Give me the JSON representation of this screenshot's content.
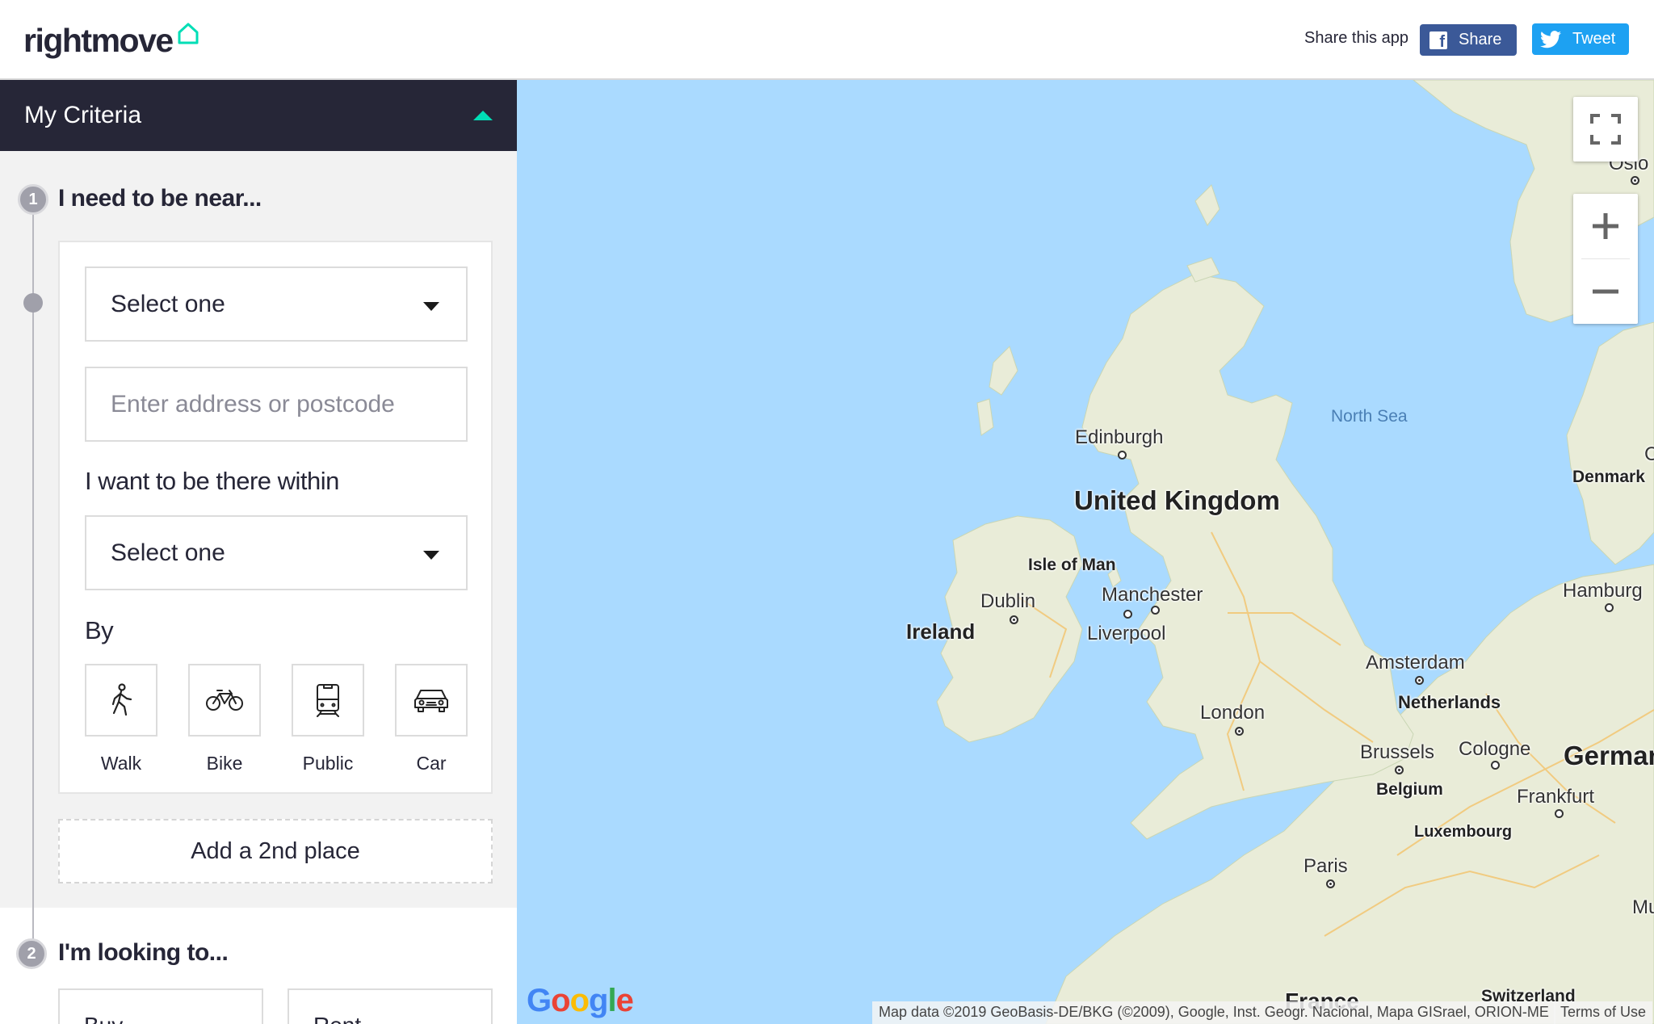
{
  "header": {
    "logo_text": "rightmove",
    "share_label": "Share this app",
    "share_button": "Share",
    "tweet_button": "Tweet",
    "colors": {
      "facebook": "#3b5998",
      "twitter": "#1da1f2",
      "brand_accent": "#00deb6"
    }
  },
  "sidebar": {
    "criteria_title": "My Criteria",
    "step1": {
      "number": "1",
      "title": "I need to be near...",
      "place_type_select": "Select one",
      "address_placeholder": "Enter address or postcode",
      "within_label": "I want to be there within",
      "time_select": "Select one",
      "by_label": "By",
      "modes": [
        {
          "label": "Walk",
          "icon": "walk-icon"
        },
        {
          "label": "Bike",
          "icon": "bike-icon"
        },
        {
          "label": "Public",
          "icon": "train-icon"
        },
        {
          "label": "Car",
          "icon": "car-icon"
        }
      ],
      "add_place": "Add a 2nd place"
    },
    "step2": {
      "number": "2",
      "title": "I'm looking to...",
      "options": [
        "Buy",
        "Rent"
      ]
    }
  },
  "map": {
    "labels": {
      "oslo": "Oslo",
      "north_sea": "North Sea",
      "denmark": "Denmark",
      "edinburgh": "Edinburgh",
      "united_kingdom": "United Kingdom",
      "isle_of_man": "Isle of Man",
      "dublin": "Dublin",
      "ireland": "Ireland",
      "manchester": "Manchester",
      "liverpool": "Liverpool",
      "hamburg": "Hamburg",
      "amsterdam": "Amsterdam",
      "netherlands": "Netherlands",
      "london": "London",
      "brussels": "Brussels",
      "cologne": "Cologne",
      "germany": "German",
      "belgium": "Belgium",
      "frankfurt": "Frankfurt",
      "luxembourg": "Luxembourg",
      "paris": "Paris",
      "france": "France",
      "switzerland": "Switzerland",
      "mu": "Mu",
      "c": "C"
    },
    "google": "Google",
    "attribution": "Map data ©2019 GeoBasis-DE/BKG (©2009), Google, Inst. Geogr. Nacional, Mapa GISrael, ORION-ME",
    "terms": "Terms of Use",
    "controls": {
      "fullscreen": "fullscreen-icon",
      "zoom_in": "plus-icon",
      "zoom_out": "minus-icon"
    }
  }
}
